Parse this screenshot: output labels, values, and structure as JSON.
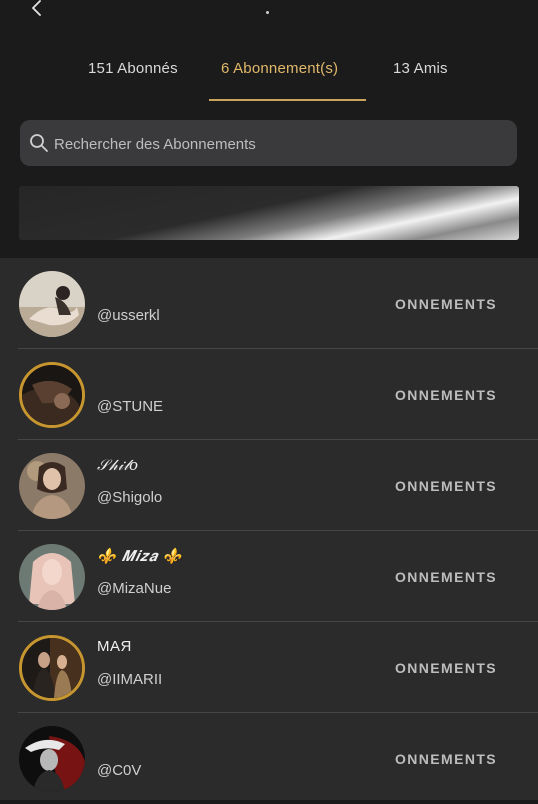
{
  "header": {
    "back_icon": "chevron-left-icon",
    "dot": "•"
  },
  "tabs": [
    {
      "label": "151 Abonnés",
      "active": false
    },
    {
      "label": "6 Abonnement(s)",
      "active": true
    },
    {
      "label": "13 Amis",
      "active": false
    }
  ],
  "search": {
    "placeholder": "Rechercher des Abonnements",
    "value": ""
  },
  "colors": {
    "accent": "#e0b86a",
    "ring": "#c7962f",
    "background": "#1b1b1b",
    "list_background": "#2b2b2b"
  },
  "subscriptions": [
    {
      "display_name": "",
      "handle": "@usserkl",
      "action": "ONNEMENTS",
      "ring": false
    },
    {
      "display_name": "",
      "handle": "@STUNE",
      "action": "ONNEMENTS",
      "ring": true
    },
    {
      "display_name": "𝒮𝒽𝒾𝓁𝑜",
      "handle": "@Shigolo",
      "action": "ONNEMENTS",
      "ring": false
    },
    {
      "display_name": "⚜️ 𝑴𝒊𝒛𝒂 ⚜️",
      "handle": "@MizaNue",
      "action": "ONNEMENTS",
      "ring": false
    },
    {
      "display_name": "МАЯ",
      "handle": "@IIMARII",
      "action": "ONNEMENTS",
      "ring": true
    },
    {
      "display_name": "",
      "handle": "@C0V",
      "action": "ONNEMENTS",
      "ring": false
    }
  ]
}
